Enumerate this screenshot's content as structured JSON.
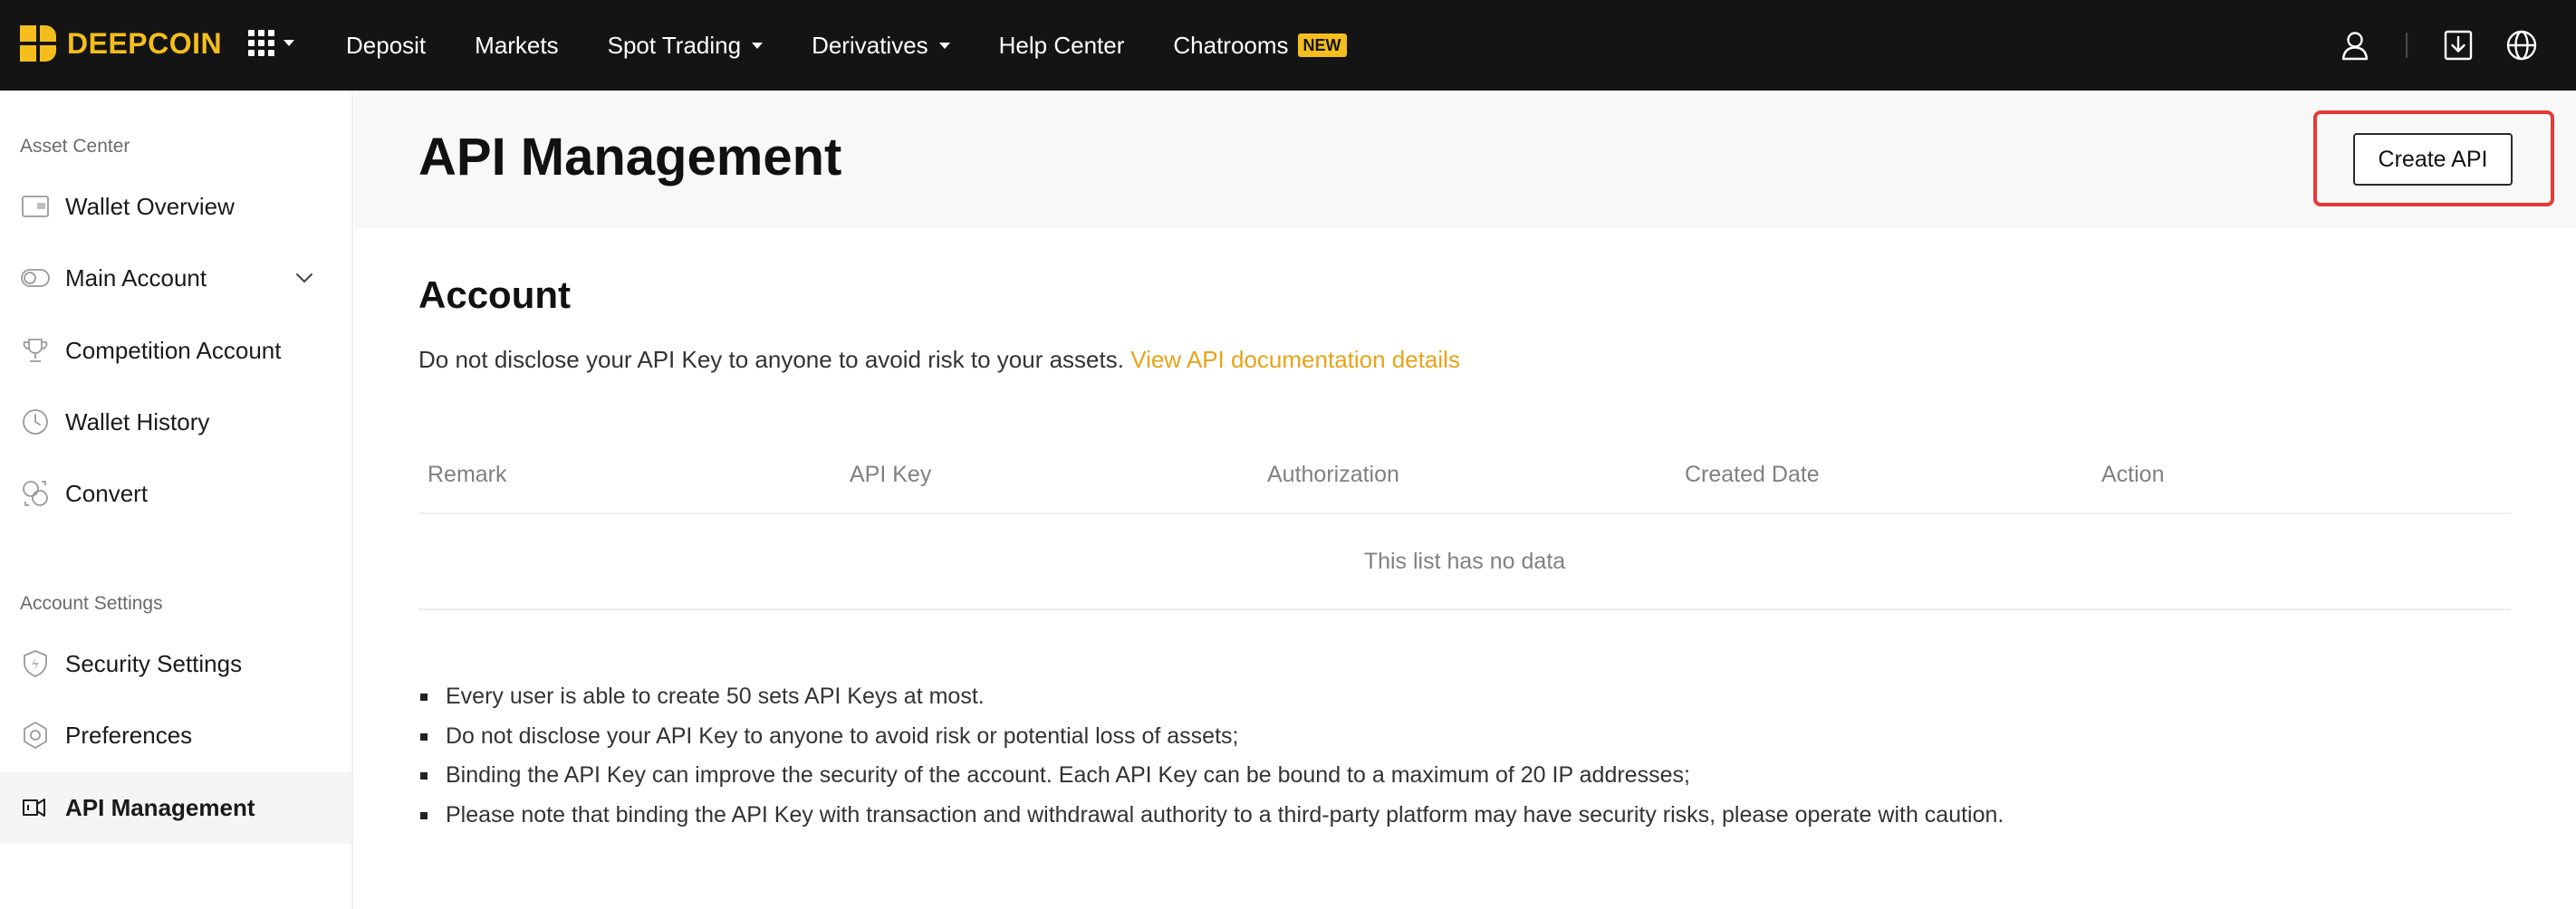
{
  "topbar": {
    "brand": "DEEPCOIN",
    "brand_color": "#F5BE1C",
    "apps_icon": "grid-apps-icon",
    "nav": [
      {
        "label": "Deposit",
        "has_dropdown": false
      },
      {
        "label": "Markets",
        "has_dropdown": false
      },
      {
        "label": "Spot Trading",
        "has_dropdown": true
      },
      {
        "label": "Derivatives",
        "has_dropdown": true
      },
      {
        "label": "Help Center",
        "has_dropdown": false
      },
      {
        "label": "Chatrooms",
        "has_dropdown": false,
        "badge": "NEW"
      }
    ],
    "right_icons": [
      "user-icon",
      "download-icon",
      "globe-icon"
    ]
  },
  "sidebar": {
    "asset_section_title": "Asset Center",
    "asset_items": [
      {
        "label": "Wallet Overview",
        "icon": "wallet-icon"
      },
      {
        "label": "Main Account",
        "icon": "toggle-icon",
        "expandable": true
      },
      {
        "label": "Competition Account",
        "icon": "trophy-icon"
      },
      {
        "label": "Wallet History",
        "icon": "clock-icon"
      },
      {
        "label": "Convert",
        "icon": "convert-icon"
      }
    ],
    "settings_section_title": "Account Settings",
    "settings_items": [
      {
        "label": "Security Settings",
        "icon": "shield-icon"
      },
      {
        "label": "Preferences",
        "icon": "hexagon-icon"
      },
      {
        "label": "API Management",
        "icon": "api-icon",
        "active": true
      }
    ]
  },
  "main": {
    "title": "API Management",
    "create_button": "Create API",
    "highlight_color": "#E53935",
    "section_title": "Account",
    "notice_text": "Do not disclose your API Key to anyone to avoid risk to your assets.",
    "notice_link": "View API documentation details",
    "link_color": "#E8A317",
    "table": {
      "columns": [
        "Remark",
        "API Key",
        "Authorization",
        "Created Date",
        "Action"
      ],
      "empty_text": "This list has no data"
    },
    "notes": [
      "Every user is able to create 50 sets API Keys at most.",
      "Do not disclose your API Key to anyone to avoid risk or potential loss of assets;",
      "Binding the API Key can improve the security of the account. Each API Key can be bound to a maximum of 20 IP addresses;",
      "Please note that binding the API Key with transaction and withdrawal authority to a third-party platform may have security risks, please operate with caution."
    ]
  }
}
